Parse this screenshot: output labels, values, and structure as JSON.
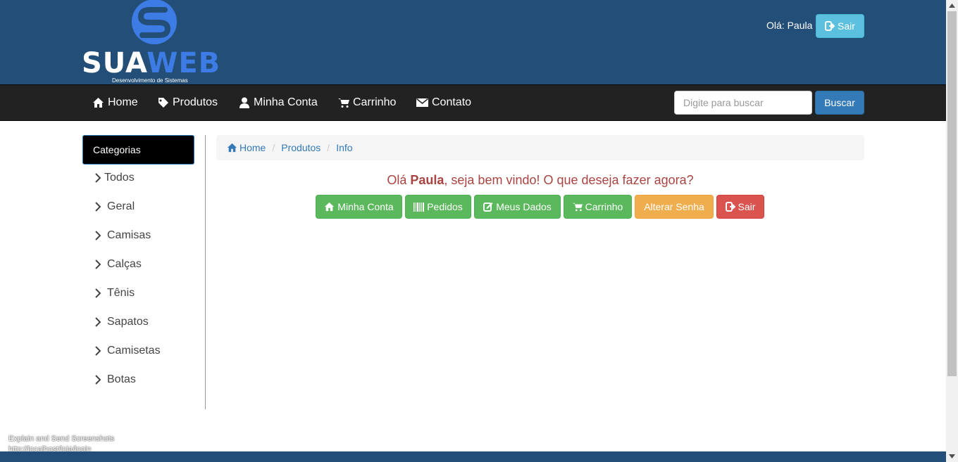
{
  "header": {
    "logo_text_1": "SUA",
    "logo_text_2": "WEB",
    "logo_subtitle": "Desenvolvimento de Sistemas",
    "greeting": "Olá: Paula",
    "logout_label": "Sair"
  },
  "navbar": {
    "items": [
      {
        "label": "Home",
        "icon": "home-icon"
      },
      {
        "label": "Produtos",
        "icon": "tag-icon"
      },
      {
        "label": "Minha Conta",
        "icon": "user-icon"
      },
      {
        "label": "Carrinho",
        "icon": "cart-icon"
      },
      {
        "label": "Contato",
        "icon": "envelope-icon"
      }
    ],
    "search_placeholder": "Digite para buscar",
    "search_button": "Buscar"
  },
  "sidebar": {
    "title": "Categorias",
    "items": [
      "Todos",
      "Geral",
      "Camisas",
      "Calças",
      "Tênis",
      "Sapatos",
      "Camisetas",
      "Botas"
    ]
  },
  "breadcrumb": {
    "items": [
      "Home",
      "Produtos",
      "Info"
    ]
  },
  "main": {
    "welcome_prefix": "Olá ",
    "user_name": "Paula",
    "welcome_suffix": ", seja bem vindo! O que deseja fazer agora?",
    "actions": [
      {
        "label": "Minha Conta",
        "icon": "home-icon"
      },
      {
        "label": "Pedidos",
        "icon": "barcode-icon"
      },
      {
        "label": "Meus Dados",
        "icon": "edit-icon"
      },
      {
        "label": "Carrinho",
        "icon": "cart-icon"
      },
      {
        "label": "Alterar Senha",
        "icon": ""
      },
      {
        "label": "Sair",
        "icon": "logout-icon"
      }
    ]
  },
  "status_overlay": {
    "line1": "Explain and Send Screenshots",
    "line2": "http://localhost/loja/login"
  },
  "colors": {
    "header_bg": "#234e77",
    "navbar_bg": "#222222",
    "logo_blue": "#3d7be5",
    "success": "#5cb85c",
    "warning": "#f0ad4e",
    "danger": "#d9534f",
    "info": "#5bc0de",
    "primary": "#337ab7"
  }
}
